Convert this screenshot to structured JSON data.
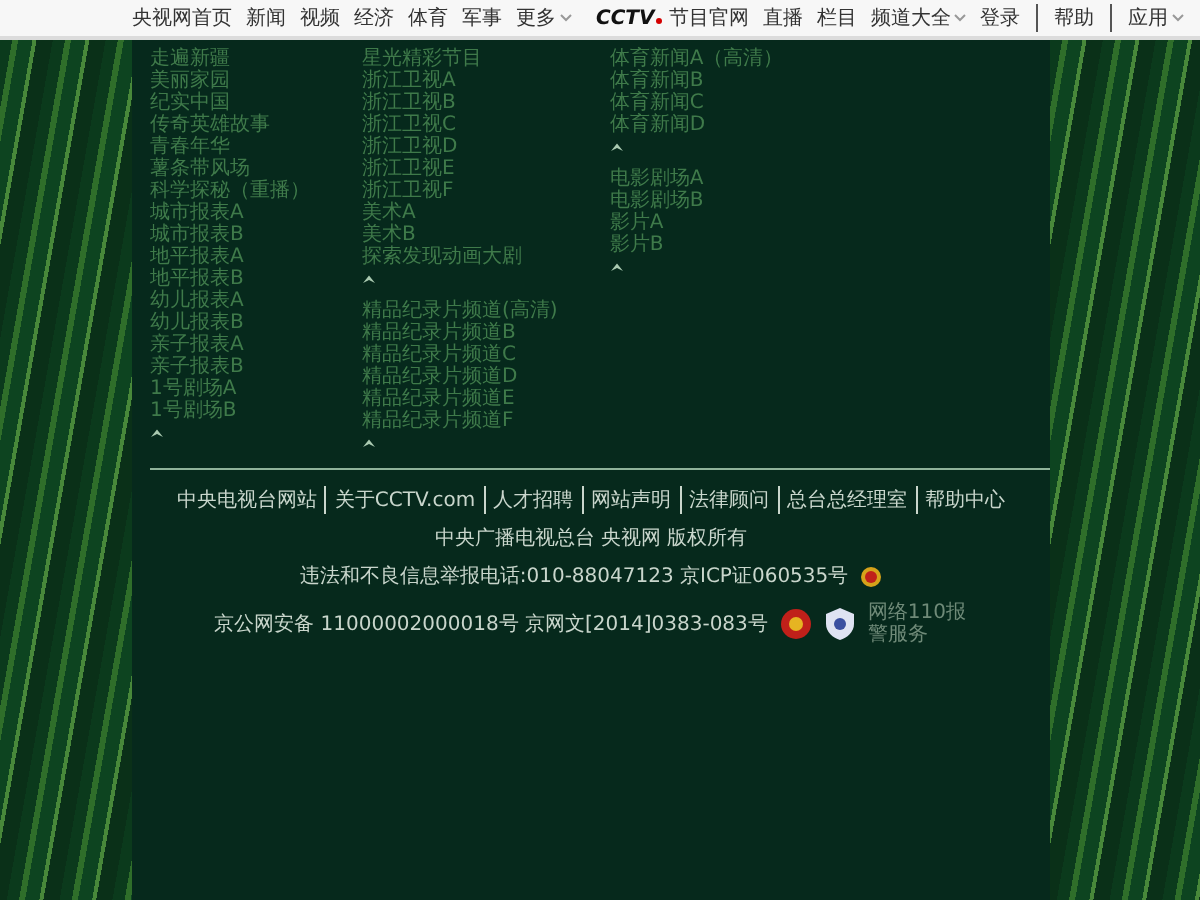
{
  "top_nav": {
    "left": [
      {
        "label": "央视网首页",
        "dropdown": false
      },
      {
        "label": "新闻",
        "dropdown": false
      },
      {
        "label": "视频",
        "dropdown": false
      },
      {
        "label": "经济",
        "dropdown": false
      },
      {
        "label": "体育",
        "dropdown": false
      },
      {
        "label": "军事",
        "dropdown": false
      },
      {
        "label": "更多",
        "dropdown": true
      }
    ],
    "logo": "CCTV",
    "middle": [
      {
        "label": "节目官网",
        "dropdown": false
      },
      {
        "label": "直播",
        "dropdown": false
      },
      {
        "label": "栏目",
        "dropdown": false
      },
      {
        "label": "频道大全",
        "dropdown": true
      }
    ],
    "right": [
      {
        "label": "登录",
        "dropdown": false
      },
      {
        "label": "帮助",
        "dropdown": false
      },
      {
        "label": "应用",
        "dropdown": true
      }
    ]
  },
  "channel_groups": [
    {
      "items": [
        "走遍新疆",
        "美丽家园",
        "纪实中国",
        "传奇英雄故事",
        "青春年华",
        "薯条带风场",
        "科学探秘（重播）",
        "城市报表A",
        "城市报表B",
        "地平报表A",
        "地平报表B",
        "幼儿报表A",
        "幼儿报表B",
        "亲子报表A",
        "亲子报表B",
        "1号剧场A",
        "1号剧场B"
      ]
    },
    {
      "items": [
        "星光精彩节目",
        "浙江卫视A",
        "浙江卫视B",
        "浙江卫视C",
        "浙江卫视D",
        "浙江卫视E",
        "浙江卫视F",
        "美术A",
        "美术B",
        "探索发现动画大剧"
      ]
    },
    {
      "items": [
        "精品纪录片频道(高清)",
        "精品纪录片频道B",
        "精品纪录片频道C",
        "精品纪录片频道D",
        "精品纪录片频道E",
        "精品纪录片频道F"
      ]
    },
    {
      "items": [
        "体育新闻A（高清）",
        "体育新闻B",
        "体育新闻C",
        "体育新闻D"
      ]
    },
    {
      "items": [
        "电影剧场A",
        "电影剧场B",
        "影片A",
        "影片B"
      ]
    }
  ],
  "footer": {
    "links": [
      "中央电视台网站",
      "关于CCTV.com",
      "人才招聘",
      "网站声明",
      "法律顾问",
      "总台总经理室",
      "帮助中心"
    ],
    "copyright": "中央广播电视总台 央视网 版权所有",
    "report": "违法和不良信息举报电话:010-88047123 京ICP证060535号",
    "security": "京公网安备 11000002000018号 京网文[2014]0383-083号",
    "police_text": "网络110报警服务"
  }
}
